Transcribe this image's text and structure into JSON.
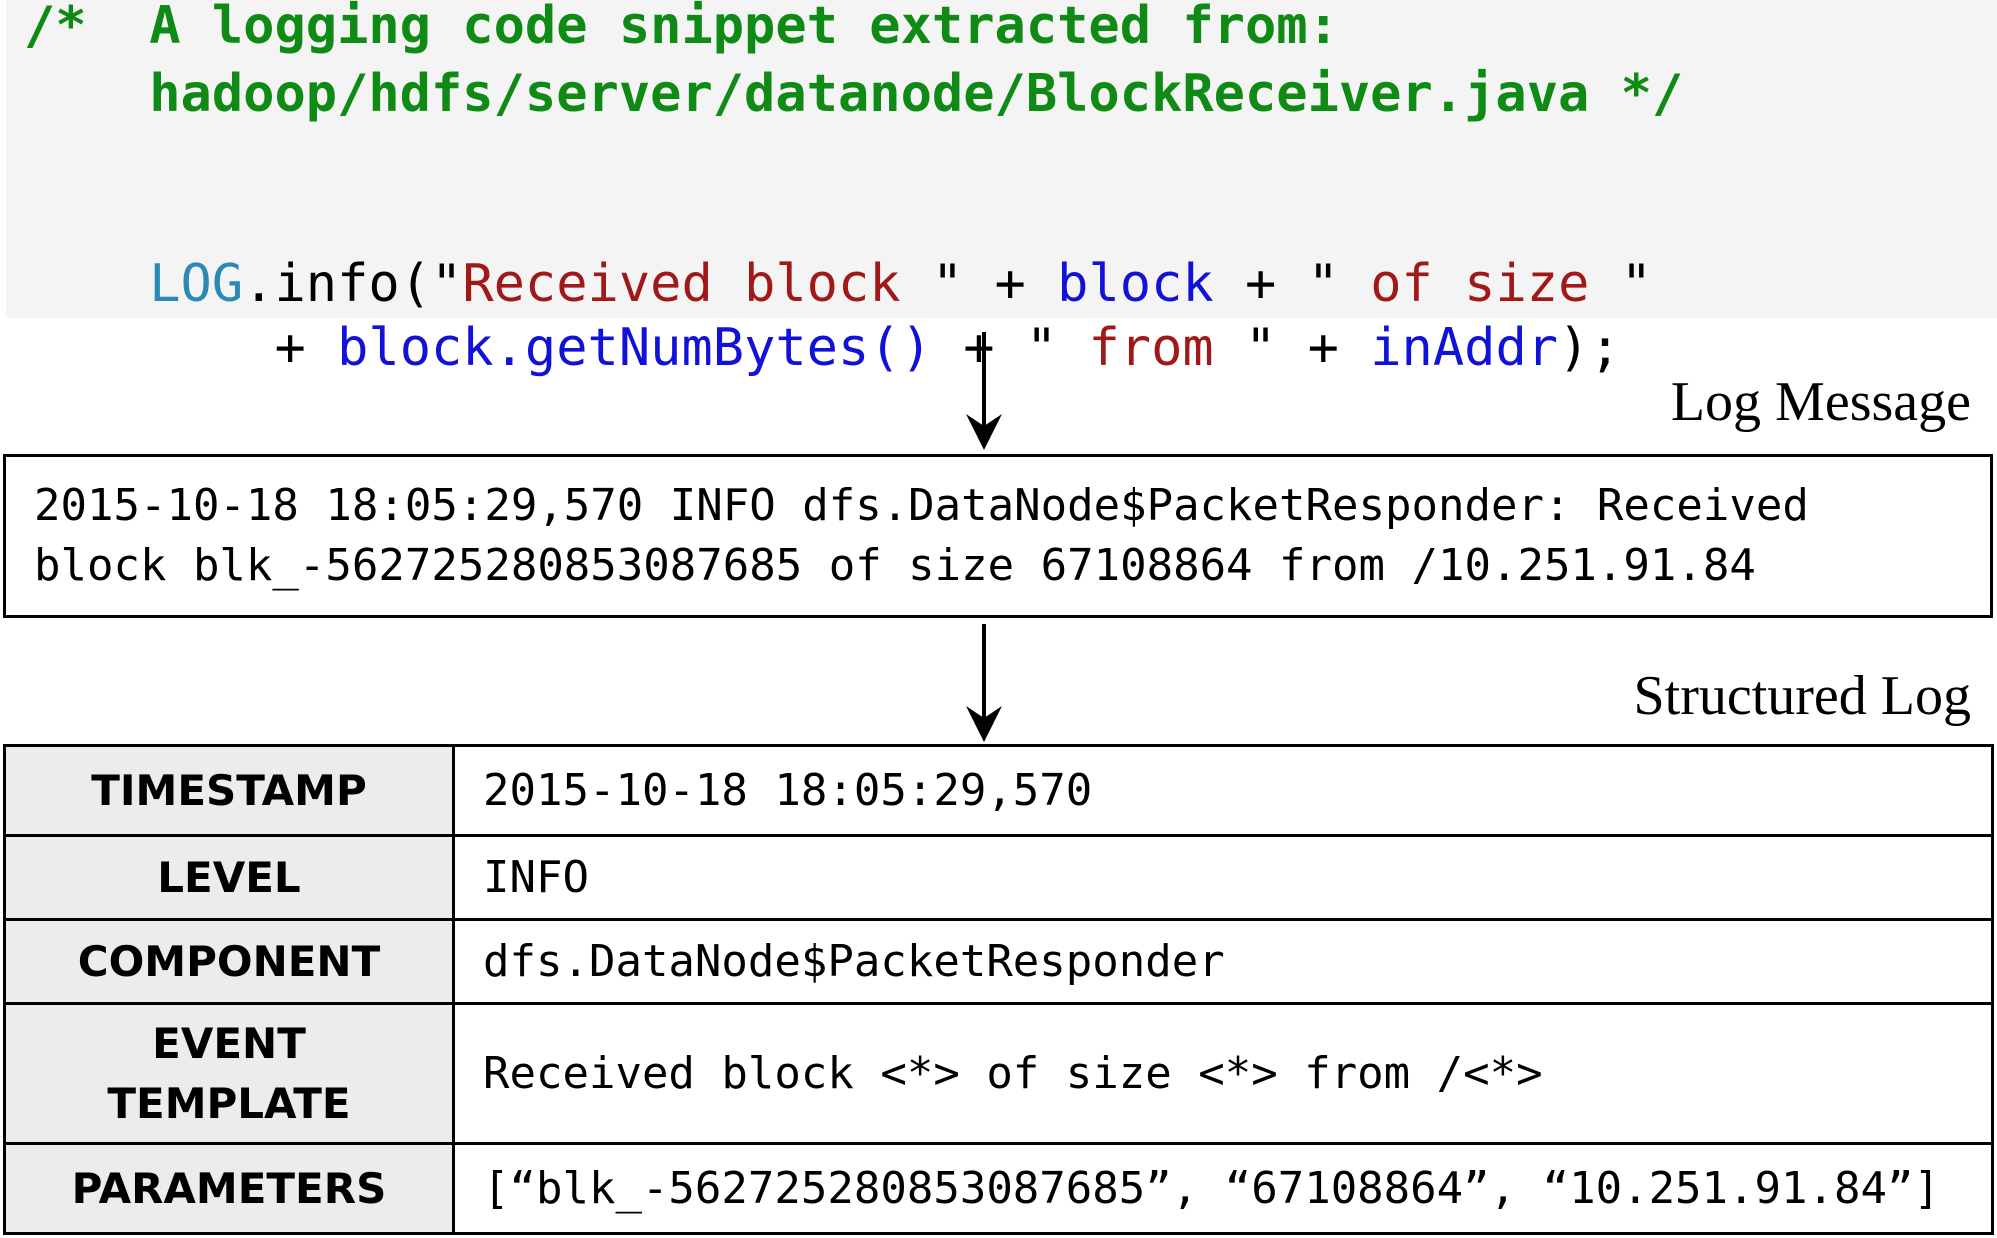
{
  "code_snippet": {
    "comment_line_1": "/*  A logging code snippet extracted from:",
    "comment_line_2": "    hadoop/hdfs/server/datanode/BlockReceiver.java */",
    "line1": [
      {
        "text": "LOG",
        "style": "kw-log"
      },
      {
        "text": ".info(\"",
        "style": "plain"
      },
      {
        "text": "Received block ",
        "style": "str"
      },
      {
        "text": "\" + ",
        "style": "plain"
      },
      {
        "text": "block",
        "style": "var"
      },
      {
        "text": " + \" ",
        "style": "plain"
      },
      {
        "text": "of size ",
        "style": "str"
      },
      {
        "text": "\"",
        "style": "plain"
      }
    ],
    "line2": [
      {
        "text": "    + ",
        "style": "plain"
      },
      {
        "text": "block.getNumBytes()",
        "style": "var"
      },
      {
        "text": " + \" ",
        "style": "plain"
      },
      {
        "text": "from ",
        "style": "str"
      },
      {
        "text": "\" + ",
        "style": "plain"
      },
      {
        "text": "inAddr",
        "style": "var"
      },
      {
        "text": ");",
        "style": "plain"
      }
    ]
  },
  "log_message": {
    "caption": "Log Message",
    "line_1": "2015-10-18 18:05:29,570 INFO dfs.DataNode$PacketResponder: Received",
    "line_2": "block blk_-562725280853087685 of size 67108864 from /10.251.91.84"
  },
  "structured_log": {
    "caption": "Structured Log",
    "rows": [
      {
        "key": "TIMESTAMP",
        "value": "2015-10-18 18:05:29,570"
      },
      {
        "key": "LEVEL",
        "value": "INFO"
      },
      {
        "key": "COMPONENT",
        "value": "dfs.DataNode$PacketResponder"
      },
      {
        "key_line_1": "EVENT",
        "key_line_2": "TEMPLATE",
        "value": "Received block <*> of size <*> from /<*>"
      },
      {
        "key": "PARAMETERS",
        "value": "[“blk_-562725280853087685”, “67108864”, “10.251.91.84”]"
      }
    ]
  },
  "colors": {
    "comment": "#0f8a14",
    "log_keyword": "#2a8ab5",
    "string_literal": "#a01818",
    "variable": "#1111d8",
    "code_background": "#f4f4f4",
    "key_cell_background": "#ececec"
  }
}
